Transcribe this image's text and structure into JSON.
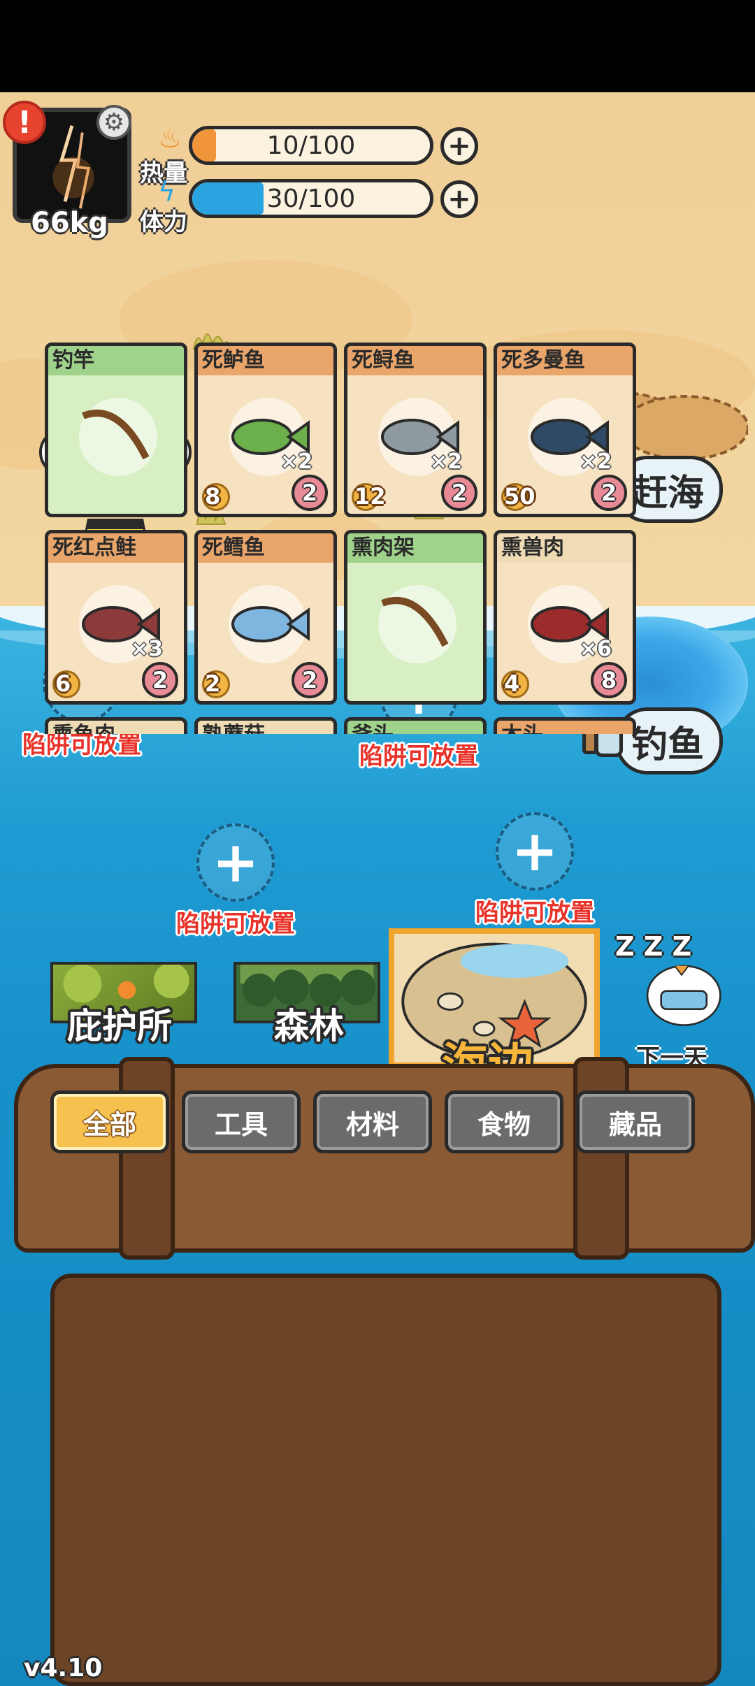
{
  "player": {
    "weight": "66kg",
    "alert_glyph": "!",
    "gear_glyph": "⚙"
  },
  "stats": [
    {
      "label": "热量",
      "value": "10/100",
      "fill_fraction": 0.1,
      "color": "#f0953a",
      "icon": "flame-icon"
    },
    {
      "label": "体力",
      "value": "30/100",
      "fill_fraction": 0.3,
      "color": "#2aa4e0",
      "icon": "lightning-icon"
    }
  ],
  "plus_glyph": "+",
  "actions": {
    "gather": "赶海",
    "fish": "钓鱼"
  },
  "traps": [
    {
      "glyph": "+",
      "label": "陷阱可放置"
    },
    {
      "glyph": "+",
      "label": "陷阱可放置"
    },
    {
      "glyph": "+",
      "label": "陷阱可放置"
    },
    {
      "glyph": "+",
      "label": "陷阱可放置"
    }
  ],
  "locations": [
    {
      "label": "庇护所",
      "selected": false
    },
    {
      "label": "森林",
      "selected": false
    },
    {
      "label": "海边",
      "selected": true
    }
  ],
  "next_day": {
    "label": "下一天",
    "zzz": "Z Z Z"
  },
  "tabs": [
    {
      "label": "全部",
      "active": true
    },
    {
      "label": "工具",
      "active": false
    },
    {
      "label": "材料",
      "active": false
    },
    {
      "label": "食物",
      "active": false
    },
    {
      "label": "藏品",
      "active": false
    }
  ],
  "items": [
    {
      "name": "钓竿",
      "kind": "tool",
      "qty": "",
      "cost": "",
      "uses": "",
      "icon": "fishing-rod-icon"
    },
    {
      "name": "死鲈鱼",
      "kind": "food",
      "qty": "×2",
      "cost": "8",
      "uses": "2",
      "icon": "bass-icon",
      "color": "#6bb04a"
    },
    {
      "name": "死鲟鱼",
      "kind": "food",
      "qty": "×2",
      "cost": "12",
      "uses": "2",
      "icon": "sturgeon-icon",
      "color": "#8e9aa0"
    },
    {
      "name": "死多曼鱼",
      "kind": "food",
      "qty": "×2",
      "cost": "50",
      "uses": "2",
      "icon": "dorman-fish-icon",
      "color": "#2f4a66"
    },
    {
      "name": "死红点鲑",
      "kind": "food",
      "qty": "×3",
      "cost": "6",
      "uses": "2",
      "icon": "red-spot-trout-icon",
      "color": "#8d3a3a"
    },
    {
      "name": "死鳕鱼",
      "kind": "food",
      "qty": "",
      "cost": "2",
      "uses": "2",
      "icon": "cod-icon",
      "color": "#7fb6e0"
    },
    {
      "name": "熏肉架",
      "kind": "tool",
      "qty": "",
      "cost": "",
      "uses": "",
      "icon": "smoking-rack-icon"
    },
    {
      "name": "熏兽肉",
      "kind": "tan",
      "qty": "×6",
      "cost": "4",
      "uses": "8",
      "icon": "smoked-meat-icon",
      "color": "#9c2b2b"
    },
    {
      "name": "熏鱼肉",
      "kind": "tan",
      "qty": "",
      "cost": "",
      "uses": "",
      "icon": "smoked-fish-icon"
    },
    {
      "name": "熟蘑菇",
      "kind": "tan",
      "qty": "",
      "cost": "",
      "uses": "",
      "icon": "cooked-mushroom-icon"
    },
    {
      "name": "斧头",
      "kind": "tool",
      "qty": "",
      "cost": "",
      "uses": "",
      "icon": "axe-icon"
    },
    {
      "name": "木头",
      "kind": "food",
      "qty": "",
      "cost": "",
      "uses": "",
      "icon": "wood-icon"
    }
  ],
  "version": "v4.10"
}
